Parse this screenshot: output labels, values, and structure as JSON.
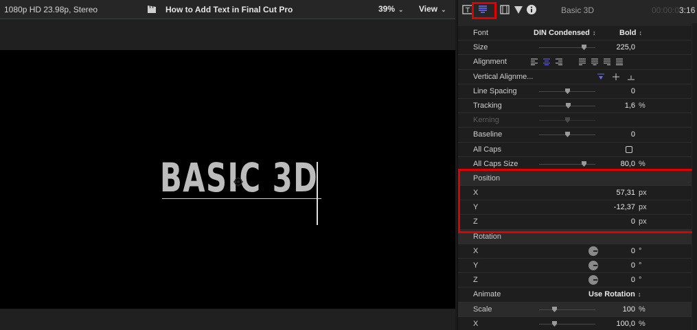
{
  "viewer": {
    "format": "1080p HD 23.98p, Stereo",
    "project_title": "How to Add Text in Final Cut Pro",
    "zoom": "39%",
    "view_label": "View",
    "canvas_text": "BASIC 3D"
  },
  "inspector": {
    "title": "Basic 3D",
    "timecode_dim": "00:00:0",
    "timecode_bright": "3:16",
    "rows": {
      "font": {
        "label": "Font",
        "family": "DIN Condensed",
        "weight": "Bold"
      },
      "size": {
        "label": "Size",
        "value": "225,0",
        "level": 0.8
      },
      "alignment": {
        "label": "Alignment"
      },
      "vertical_alignment": {
        "label": "Vertical Alignme..."
      },
      "line_spacing": {
        "label": "Line Spacing",
        "value": "0",
        "level": 0.5
      },
      "tracking": {
        "label": "Tracking",
        "value": "1,6",
        "unit": "%",
        "level": 0.52
      },
      "kerning": {
        "label": "Kerning",
        "level": 0.5
      },
      "baseline": {
        "label": "Baseline",
        "value": "0",
        "level": 0.5
      },
      "all_caps": {
        "label": "All Caps"
      },
      "all_caps_size": {
        "label": "All Caps Size",
        "value": "80,0",
        "unit": "%",
        "level": 0.8
      },
      "position": {
        "label": "Position"
      },
      "pos_x": {
        "label": "X",
        "value": "57,31",
        "unit": "px"
      },
      "pos_y": {
        "label": "Y",
        "value": "-12,37",
        "unit": "px"
      },
      "pos_z": {
        "label": "Z",
        "value": "0",
        "unit": "px"
      },
      "rotation": {
        "label": "Rotation"
      },
      "rot_x": {
        "label": "X",
        "value": "0",
        "unit": "°"
      },
      "rot_y": {
        "label": "Y",
        "value": "0",
        "unit": "°"
      },
      "rot_z": {
        "label": "Z",
        "value": "0",
        "unit": "°"
      },
      "animate": {
        "label": "Animate",
        "value": "Use Rotation"
      },
      "scale": {
        "label": "Scale",
        "value": "100",
        "unit": "%",
        "level": 0.28
      },
      "scale_x": {
        "label": "X",
        "value": "100,0",
        "unit": "%",
        "level": 0.28
      }
    }
  },
  "colors": {
    "highlight": "#e00000",
    "accent": "#6b6bff"
  },
  "icons": {
    "text_tab": "text-inspector-icon",
    "title_tab": "title-inspector-icon",
    "video_tab": "video-inspector-icon",
    "filter_tab": "filter-inspector-icon",
    "info_tab": "info-inspector-icon"
  }
}
